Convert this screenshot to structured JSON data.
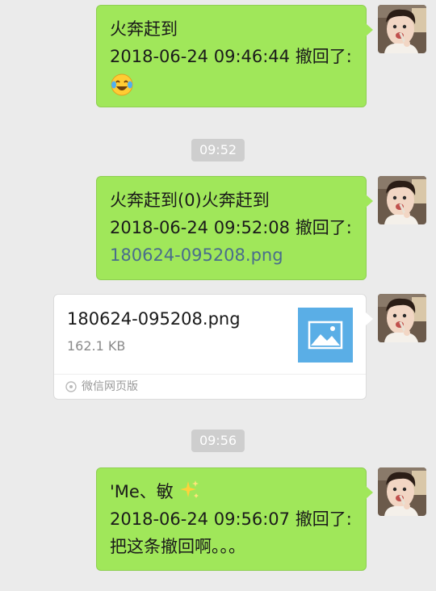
{
  "messages": [
    {
      "lines": [
        "火奔赶到",
        "2018-06-24 09:46:44 撤回了:"
      ],
      "emoji": "tears-of-joy-emoji"
    },
    {
      "time": "09:52"
    },
    {
      "lines": [
        "火奔赶到(0)火奔赶到",
        "2018-06-24 09:52:08 撤回了:"
      ],
      "link": "180624-095208.png"
    },
    {
      "card": {
        "title": "180624-095208.png",
        "size": "162.1 KB",
        "source": "微信网页版",
        "thumb_icon": "image-placeholder-icon",
        "footer_icon": "mini-program-icon"
      }
    },
    {
      "time": "09:56"
    },
    {
      "lines": [
        "'Me、敏",
        "2018-06-24 09:56:07 撤回了:",
        "把这条撤回啊。。。"
      ],
      "inline_emoji": "sparkles-emoji"
    }
  ],
  "colors": {
    "background": "#ebebeb",
    "bubble": "#a0e75a",
    "link": "#4a6d8c",
    "time_pill": "#cecece"
  }
}
